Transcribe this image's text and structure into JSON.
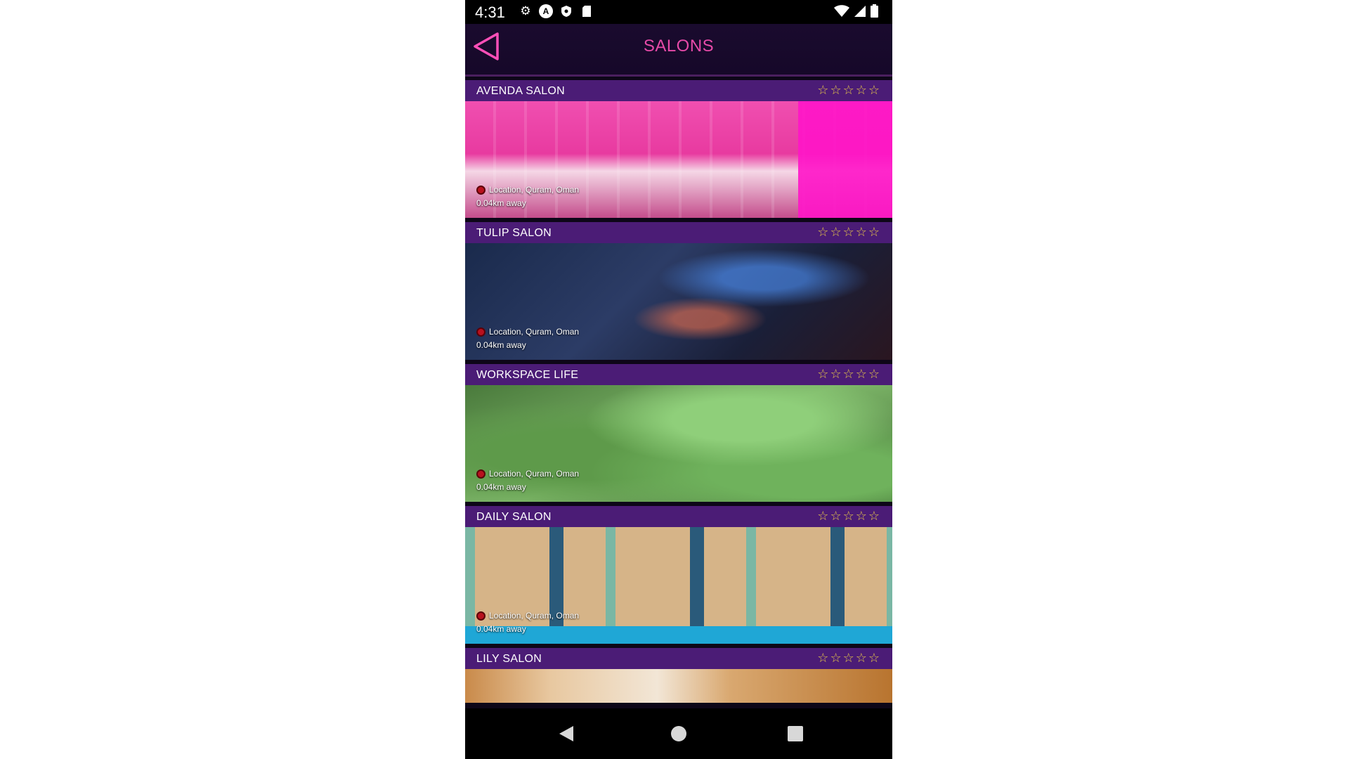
{
  "status_bar": {
    "time": "4:31",
    "left_icons": [
      "settings-icon",
      "a-circle-icon",
      "shield-icon",
      "sd-card-icon"
    ],
    "right_icons": [
      "wifi-icon",
      "signal-icon",
      "battery-icon"
    ]
  },
  "header": {
    "title": "SALONS",
    "back_icon": "back-triangle-icon",
    "accent_color": "#e64aa8"
  },
  "salons": [
    {
      "name": "AVENDA SALON",
      "location": "Location, Quram, Oman",
      "distance": "0.04km away",
      "rating": 0,
      "max_rating": 5
    },
    {
      "name": "TULIP SALON",
      "location": "Location, Quram, Oman",
      "distance": "0.04km away",
      "rating": 0,
      "max_rating": 5
    },
    {
      "name": "WORKSPACE LIFE",
      "location": "Location, Quram, Oman",
      "distance": "0.04km away",
      "rating": 0,
      "max_rating": 5
    },
    {
      "name": "DAILY SALON",
      "location": "Location, Quram, Oman",
      "distance": "0.04km away",
      "rating": 0,
      "max_rating": 5
    },
    {
      "name": "LILY SALON",
      "rating": 0,
      "max_rating": 5
    }
  ],
  "colors": {
    "title_bar": "#4b1c76",
    "star": "#e6c64a",
    "pin": "#b8111e"
  },
  "nav_bar": {
    "icons": [
      "nav-back-icon",
      "nav-home-icon",
      "nav-recents-icon"
    ]
  }
}
